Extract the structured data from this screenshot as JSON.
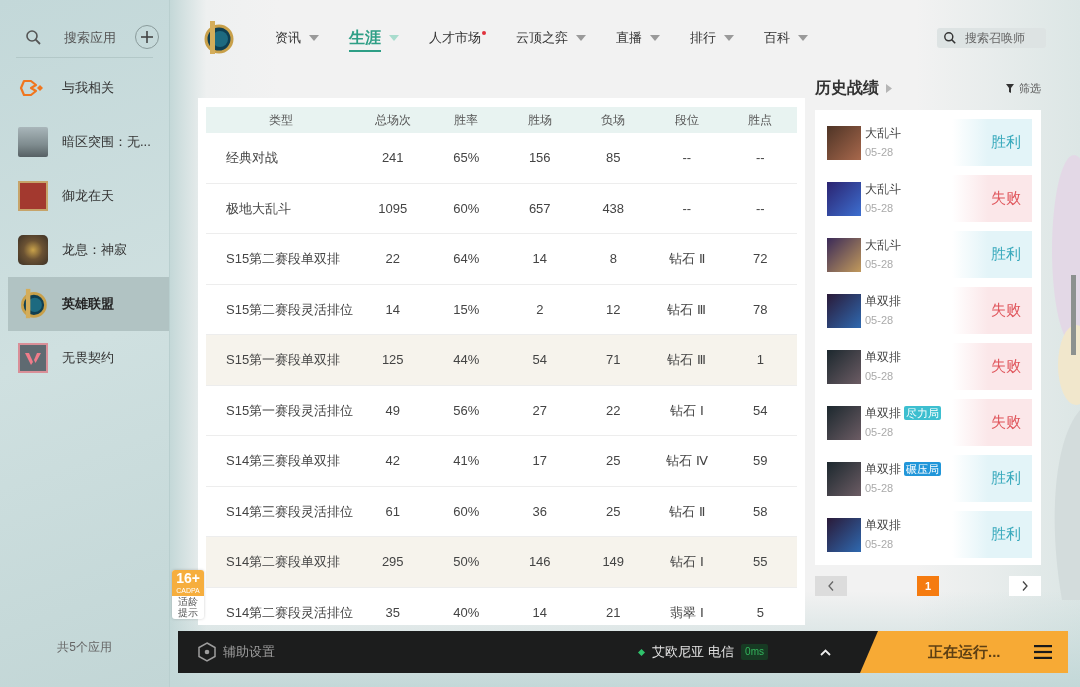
{
  "sidebar": {
    "search": {
      "placeholder": "搜索应用"
    },
    "items": [
      {
        "kind": "feed",
        "label": "与我相关",
        "selected": false
      },
      {
        "kind": "game",
        "label": "暗区突围：无...",
        "selected": false
      },
      {
        "kind": "game",
        "label": "御龙在天",
        "selected": false
      },
      {
        "kind": "game",
        "label": "龙息：神寂",
        "selected": false
      },
      {
        "kind": "game",
        "label": "英雄联盟",
        "selected": true
      },
      {
        "kind": "game",
        "label": "无畏契约",
        "selected": false
      }
    ],
    "footer": "共5个应用"
  },
  "nav": {
    "tabs": [
      {
        "label": "资讯",
        "selected": false,
        "dropdown": true,
        "notification": false
      },
      {
        "label": "生涯",
        "selected": true,
        "dropdown": true,
        "notification": false
      },
      {
        "label": "人才市场",
        "selected": false,
        "dropdown": false,
        "notification": true
      },
      {
        "label": "云顶之弈",
        "selected": false,
        "dropdown": true,
        "notification": false
      },
      {
        "label": "直播",
        "selected": false,
        "dropdown": true,
        "notification": false
      },
      {
        "label": "排行",
        "selected": false,
        "dropdown": true,
        "notification": false
      },
      {
        "label": "百科",
        "selected": false,
        "dropdown": true,
        "notification": false
      }
    ],
    "search": {
      "placeholder": "搜索召唤师"
    }
  },
  "stats_table": {
    "columns": [
      "类型",
      "总场次",
      "胜率",
      "胜场",
      "负场",
      "段位",
      "胜点"
    ],
    "rows": [
      {
        "cells": [
          "经典对战",
          "241",
          "65%",
          "156",
          "85",
          "--",
          "--"
        ],
        "highlighted": false
      },
      {
        "cells": [
          "极地大乱斗",
          "1095",
          "60%",
          "657",
          "438",
          "--",
          "--"
        ],
        "highlighted": false
      },
      {
        "cells": [
          "S15第二赛段单双排",
          "22",
          "64%",
          "14",
          "8",
          "钻石 Ⅱ",
          "72"
        ],
        "highlighted": false
      },
      {
        "cells": [
          "S15第二赛段灵活排位",
          "14",
          "15%",
          "2",
          "12",
          "钻石 Ⅲ",
          "78"
        ],
        "highlighted": false
      },
      {
        "cells": [
          "S15第一赛段单双排",
          "125",
          "44%",
          "54",
          "71",
          "钻石 Ⅲ",
          "1"
        ],
        "highlighted": true
      },
      {
        "cells": [
          "S15第一赛段灵活排位",
          "49",
          "56%",
          "27",
          "22",
          "钻石 Ⅰ",
          "54"
        ],
        "highlighted": false
      },
      {
        "cells": [
          "S14第三赛段单双排",
          "42",
          "41%",
          "17",
          "25",
          "钻石 Ⅳ",
          "59"
        ],
        "highlighted": false
      },
      {
        "cells": [
          "S14第三赛段灵活排位",
          "61",
          "60%",
          "36",
          "25",
          "钻石 Ⅱ",
          "58"
        ],
        "highlighted": false
      },
      {
        "cells": [
          "S14第二赛段单双排",
          "295",
          "50%",
          "146",
          "149",
          "钻石 Ⅰ",
          "55"
        ],
        "highlighted": true
      },
      {
        "cells": [
          "S14第二赛段灵活排位",
          "35",
          "40%",
          "14",
          "21",
          "翡翠 Ⅰ",
          "5"
        ],
        "highlighted": false
      }
    ]
  },
  "age_rating": {
    "rating": "16+",
    "org": "CADPA",
    "caption": "适龄提示"
  },
  "history": {
    "title": "历史战绩",
    "filter": "筛选",
    "matches": [
      {
        "mode": "大乱斗",
        "date": "05-28",
        "result": "胜利",
        "win": true
      },
      {
        "mode": "大乱斗",
        "date": "05-28",
        "result": "失败",
        "win": false
      },
      {
        "mode": "大乱斗",
        "date": "05-28",
        "result": "胜利",
        "win": true
      },
      {
        "mode": "单双排",
        "date": "05-28",
        "result": "失败",
        "win": false
      },
      {
        "mode": "单双排",
        "date": "05-28",
        "result": "失败",
        "win": false
      },
      {
        "mode": "单双排",
        "tag": {
          "label": "尽力局",
          "color": "#3dbfd0"
        },
        "date": "05-28",
        "result": "失败",
        "win": false
      },
      {
        "mode": "单双排",
        "tag": {
          "label": "碾压局",
          "color": "#2196d9"
        },
        "date": "05-28",
        "result": "胜利",
        "win": true
      },
      {
        "mode": "单双排",
        "date": "05-28",
        "result": "胜利",
        "win": true
      }
    ],
    "pagination": {
      "pages": [
        {
          "label": "1",
          "selected": true
        }
      ]
    }
  },
  "bottom_bar": {
    "settings": "辅助设置",
    "server": "艾欧尼亚 电信",
    "ping": "0ms",
    "status": "正在运行..."
  }
}
